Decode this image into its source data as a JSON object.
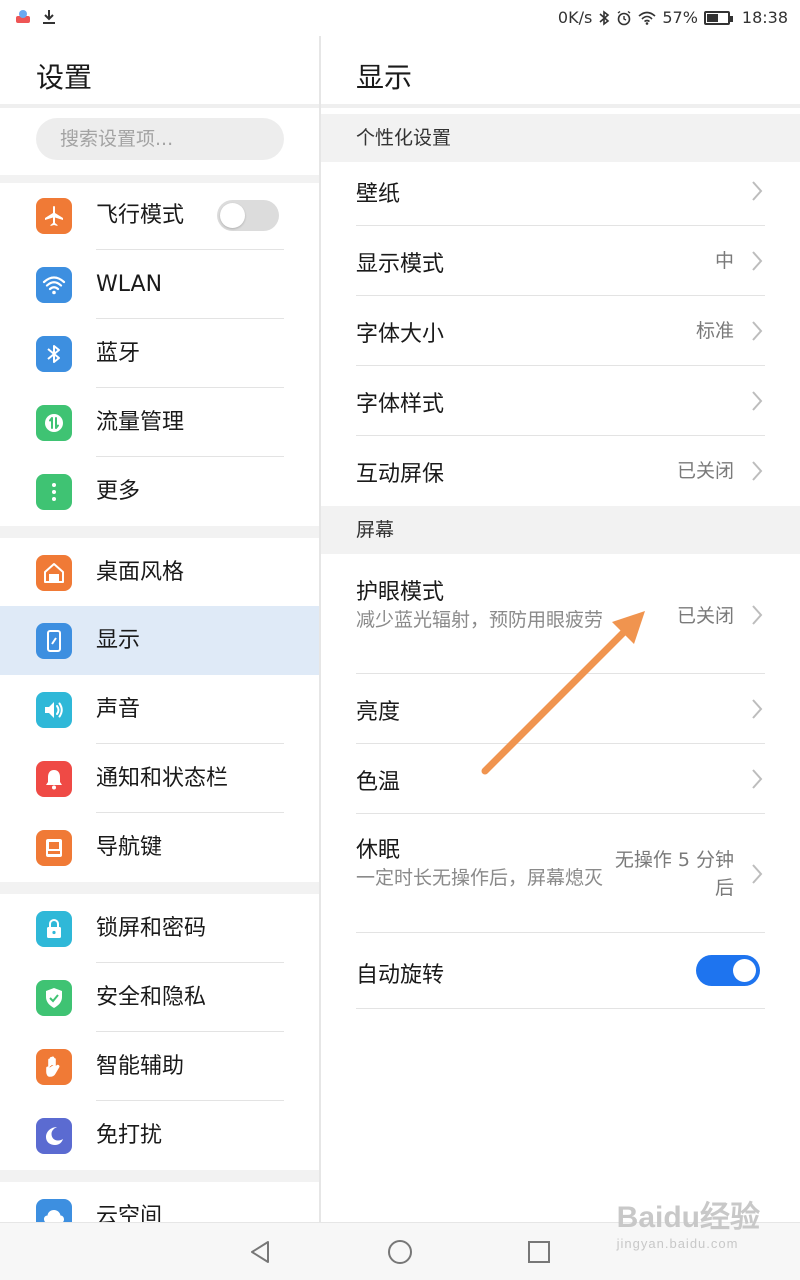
{
  "status_bar": {
    "speed": "0K/s",
    "battery_percent": "57%",
    "battery_level": 0.57,
    "time": "18:38",
    "icons": [
      "app-icon",
      "download-icon",
      "bluetooth-icon",
      "alarm-icon",
      "wifi-icon",
      "battery-icon"
    ]
  },
  "left_panel": {
    "title": "设置",
    "search_placeholder": "搜索设置项...",
    "items": [
      {
        "label": "飞行模式",
        "icon": "airplane-icon",
        "color": "#f07a36",
        "toggle": "off"
      },
      {
        "label": "WLAN",
        "icon": "wifi-icon",
        "color": "#3d8fe0"
      },
      {
        "label": "蓝牙",
        "icon": "bluetooth-icon",
        "color": "#3d8fe0"
      },
      {
        "label": "流量管理",
        "icon": "data-usage-icon",
        "color": "#3fc373"
      },
      {
        "label": "更多",
        "icon": "more-icon",
        "color": "#3fc373"
      },
      {
        "label": "桌面风格",
        "icon": "home-icon",
        "color": "#f07a36"
      },
      {
        "label": "显示",
        "icon": "display-icon",
        "color": "#3d8fe0",
        "selected": true
      },
      {
        "label": "声音",
        "icon": "sound-icon",
        "color": "#2fb8d8"
      },
      {
        "label": "通知和状态栏",
        "icon": "bell-icon",
        "color": "#ef4a45"
      },
      {
        "label": "导航键",
        "icon": "navigation-key-icon",
        "color": "#f07a36"
      },
      {
        "label": "锁屏和密码",
        "icon": "lock-icon",
        "color": "#2fb8d8"
      },
      {
        "label": "安全和隐私",
        "icon": "shield-icon",
        "color": "#3fc373"
      },
      {
        "label": "智能辅助",
        "icon": "hand-icon",
        "color": "#f07a36"
      },
      {
        "label": "免打扰",
        "icon": "moon-icon",
        "color": "#5b6bd1"
      },
      {
        "label": "云空间",
        "icon": "cloud-icon",
        "color": "#3d8fe0"
      }
    ]
  },
  "right_panel": {
    "title": "显示",
    "section_personal": "个性化设置",
    "section_screen": "屏幕",
    "rows": {
      "wallpaper": {
        "label": "壁纸",
        "value": ""
      },
      "display_mode": {
        "label": "显示模式",
        "value": "中"
      },
      "font_size": {
        "label": "字体大小",
        "value": "标准"
      },
      "font_style": {
        "label": "字体样式",
        "value": ""
      },
      "screensaver": {
        "label": "互动屏保",
        "value": "已关闭"
      },
      "eye_comfort": {
        "label": "护眼模式",
        "sub": "减少蓝光辐射，预防用眼疲劳",
        "value": "已关闭"
      },
      "brightness": {
        "label": "亮度",
        "value": ""
      },
      "color_temp": {
        "label": "色温",
        "value": ""
      },
      "sleep": {
        "label": "休眠",
        "sub": "一定时长无操作后，屏幕熄灭",
        "value": "无操作 5 分钟后"
      },
      "auto_rotate": {
        "label": "自动旋转",
        "toggle": "on"
      }
    }
  },
  "colors": {
    "accent": "#1e74ef",
    "annotation_arrow": "#f0944f",
    "selected_bg": "#dfeaf7"
  },
  "watermark": {
    "main": "Baidu经验",
    "sub": "jingyan.baidu.com"
  }
}
